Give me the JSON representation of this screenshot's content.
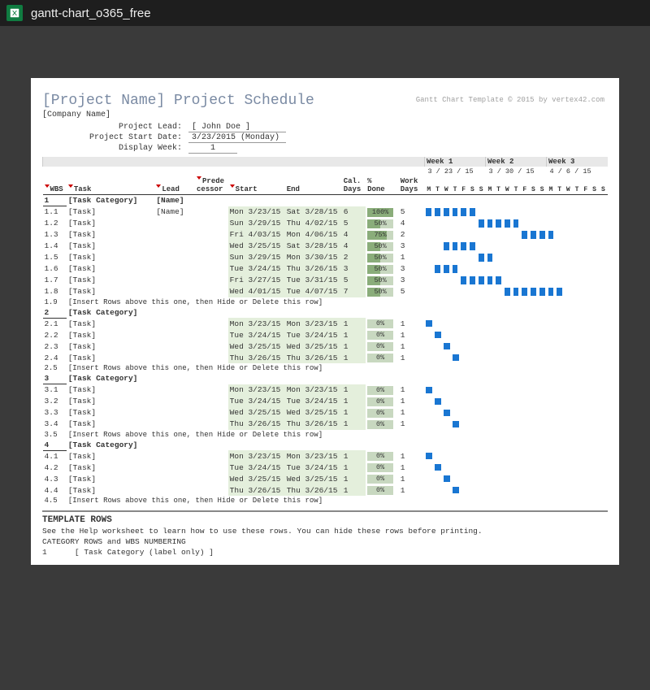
{
  "window": {
    "filename": "gantt-chart_o365_free"
  },
  "header": {
    "title": "[Project Name] Project Schedule",
    "company": "[Company Name]",
    "credit": "Gantt Chart Template © 2015 by vertex42.com",
    "lead_label": "Project Lead:",
    "lead_value": "[ John Doe ]",
    "start_label": "Project Start Date:",
    "start_value": "3/23/2015 (Monday)",
    "week_label": "Display Week:",
    "week_value": "1"
  },
  "columns": {
    "wbs": "WBS",
    "task": "Task",
    "lead": "Lead",
    "pred": "Prede\ncessor",
    "start": "Start",
    "end": "End",
    "cal": "Cal.\nDays",
    "pct": "%\nDone",
    "work": "Work\nDays"
  },
  "weeks": [
    {
      "label": "Week 1",
      "date": "3 / 23 / 15"
    },
    {
      "label": "Week 2",
      "date": "3 / 30 / 15"
    },
    {
      "label": "Week 3",
      "date": "4 / 6 / 15"
    }
  ],
  "day_letters": [
    "M",
    "T",
    "W",
    "T",
    "F",
    "S",
    "S",
    "M",
    "T",
    "W",
    "T",
    "F",
    "S",
    "S",
    "M",
    "T",
    "W",
    "T",
    "F",
    "S",
    "S"
  ],
  "rows": [
    {
      "type": "cat",
      "wbs": "1",
      "task": "[Task Category]",
      "lead": "[Name]"
    },
    {
      "type": "task",
      "wbs": "1.1",
      "task": "[Task]",
      "lead": "[Name]",
      "start": "Mon 3/23/15",
      "end": "Sat 3/28/15",
      "cal": "6",
      "pct": 100,
      "work": "5",
      "bar": [
        0,
        6
      ]
    },
    {
      "type": "task",
      "wbs": "1.2",
      "task": "[Task]",
      "lead": "",
      "start": "Sun 3/29/15",
      "end": "Thu 4/02/15",
      "cal": "5",
      "pct": 50,
      "work": "4",
      "bar": [
        6,
        5
      ]
    },
    {
      "type": "task",
      "wbs": "1.3",
      "task": "[Task]",
      "lead": "",
      "start": "Fri 4/03/15",
      "end": "Mon 4/06/15",
      "cal": "4",
      "pct": 75,
      "work": "2",
      "bar": [
        11,
        4
      ]
    },
    {
      "type": "task",
      "wbs": "1.4",
      "task": "[Task]",
      "lead": "",
      "start": "Wed 3/25/15",
      "end": "Sat 3/28/15",
      "cal": "4",
      "pct": 50,
      "work": "3",
      "bar": [
        2,
        4
      ]
    },
    {
      "type": "task",
      "wbs": "1.5",
      "task": "[Task]",
      "lead": "",
      "start": "Sun 3/29/15",
      "end": "Mon 3/30/15",
      "cal": "2",
      "pct": 50,
      "work": "1",
      "bar": [
        6,
        2
      ]
    },
    {
      "type": "task",
      "wbs": "1.6",
      "task": "[Task]",
      "lead": "",
      "start": "Tue 3/24/15",
      "end": "Thu 3/26/15",
      "cal": "3",
      "pct": 50,
      "work": "3",
      "bar": [
        1,
        3
      ]
    },
    {
      "type": "task",
      "wbs": "1.7",
      "task": "[Task]",
      "lead": "",
      "start": "Fri 3/27/15",
      "end": "Tue 3/31/15",
      "cal": "5",
      "pct": 50,
      "work": "3",
      "bar": [
        4,
        5
      ]
    },
    {
      "type": "task",
      "wbs": "1.8",
      "task": "[Task]",
      "lead": "",
      "start": "Wed 4/01/15",
      "end": "Tue 4/07/15",
      "cal": "7",
      "pct": 50,
      "work": "5",
      "bar": [
        9,
        7
      ]
    },
    {
      "type": "insert",
      "wbs": "1.9",
      "text": "[Insert Rows above this one, then Hide or Delete this row]"
    },
    {
      "type": "cat",
      "wbs": "2",
      "task": "[Task Category]"
    },
    {
      "type": "task",
      "wbs": "2.1",
      "task": "[Task]",
      "lead": "",
      "start": "Mon 3/23/15",
      "end": "Mon 3/23/15",
      "cal": "1",
      "pct": 0,
      "work": "1",
      "sq": 0
    },
    {
      "type": "task",
      "wbs": "2.2",
      "task": "[Task]",
      "lead": "",
      "start": "Tue 3/24/15",
      "end": "Tue 3/24/15",
      "cal": "1",
      "pct": 0,
      "work": "1",
      "sq": 1
    },
    {
      "type": "task",
      "wbs": "2.3",
      "task": "[Task]",
      "lead": "",
      "start": "Wed 3/25/15",
      "end": "Wed 3/25/15",
      "cal": "1",
      "pct": 0,
      "work": "1",
      "sq": 2
    },
    {
      "type": "task",
      "wbs": "2.4",
      "task": "[Task]",
      "lead": "",
      "start": "Thu 3/26/15",
      "end": "Thu 3/26/15",
      "cal": "1",
      "pct": 0,
      "work": "1",
      "sq": 3
    },
    {
      "type": "insert",
      "wbs": "2.5",
      "text": "[Insert Rows above this one, then Hide or Delete this row]"
    },
    {
      "type": "cat",
      "wbs": "3",
      "task": "[Task Category]"
    },
    {
      "type": "task",
      "wbs": "3.1",
      "task": "[Task]",
      "lead": "",
      "start": "Mon 3/23/15",
      "end": "Mon 3/23/15",
      "cal": "1",
      "pct": 0,
      "work": "1",
      "sq": 0
    },
    {
      "type": "task",
      "wbs": "3.2",
      "task": "[Task]",
      "lead": "",
      "start": "Tue 3/24/15",
      "end": "Tue 3/24/15",
      "cal": "1",
      "pct": 0,
      "work": "1",
      "sq": 1
    },
    {
      "type": "task",
      "wbs": "3.3",
      "task": "[Task]",
      "lead": "",
      "start": "Wed 3/25/15",
      "end": "Wed 3/25/15",
      "cal": "1",
      "pct": 0,
      "work": "1",
      "sq": 2
    },
    {
      "type": "task",
      "wbs": "3.4",
      "task": "[Task]",
      "lead": "",
      "start": "Thu 3/26/15",
      "end": "Thu 3/26/15",
      "cal": "1",
      "pct": 0,
      "work": "1",
      "sq": 3
    },
    {
      "type": "insert",
      "wbs": "3.5",
      "text": "[Insert Rows above this one, then Hide or Delete this row]"
    },
    {
      "type": "cat",
      "wbs": "4",
      "task": "[Task Category]"
    },
    {
      "type": "task",
      "wbs": "4.1",
      "task": "[Task]",
      "lead": "",
      "start": "Mon 3/23/15",
      "end": "Mon 3/23/15",
      "cal": "1",
      "pct": 0,
      "work": "1",
      "sq": 0
    },
    {
      "type": "task",
      "wbs": "4.2",
      "task": "[Task]",
      "lead": "",
      "start": "Tue 3/24/15",
      "end": "Tue 3/24/15",
      "cal": "1",
      "pct": 0,
      "work": "1",
      "sq": 1
    },
    {
      "type": "task",
      "wbs": "4.3",
      "task": "[Task]",
      "lead": "",
      "start": "Wed 3/25/15",
      "end": "Wed 3/25/15",
      "cal": "1",
      "pct": 0,
      "work": "1",
      "sq": 2
    },
    {
      "type": "task",
      "wbs": "4.4",
      "task": "[Task]",
      "lead": "",
      "start": "Thu 3/26/15",
      "end": "Thu 3/26/15",
      "cal": "1",
      "pct": 0,
      "work": "1",
      "sq": 3
    },
    {
      "type": "insert",
      "wbs": "4.5",
      "text": "[Insert Rows above this one, then Hide or Delete this row]"
    }
  ],
  "template": {
    "title": "TEMPLATE ROWS",
    "desc": "See the Help worksheet to learn how to use these rows. You can hide these rows before printing.",
    "sub": "CATEGORY ROWS and WBS NUMBERING",
    "row_wbs": "1",
    "row_text": "[ Task Category (label only) ]"
  }
}
